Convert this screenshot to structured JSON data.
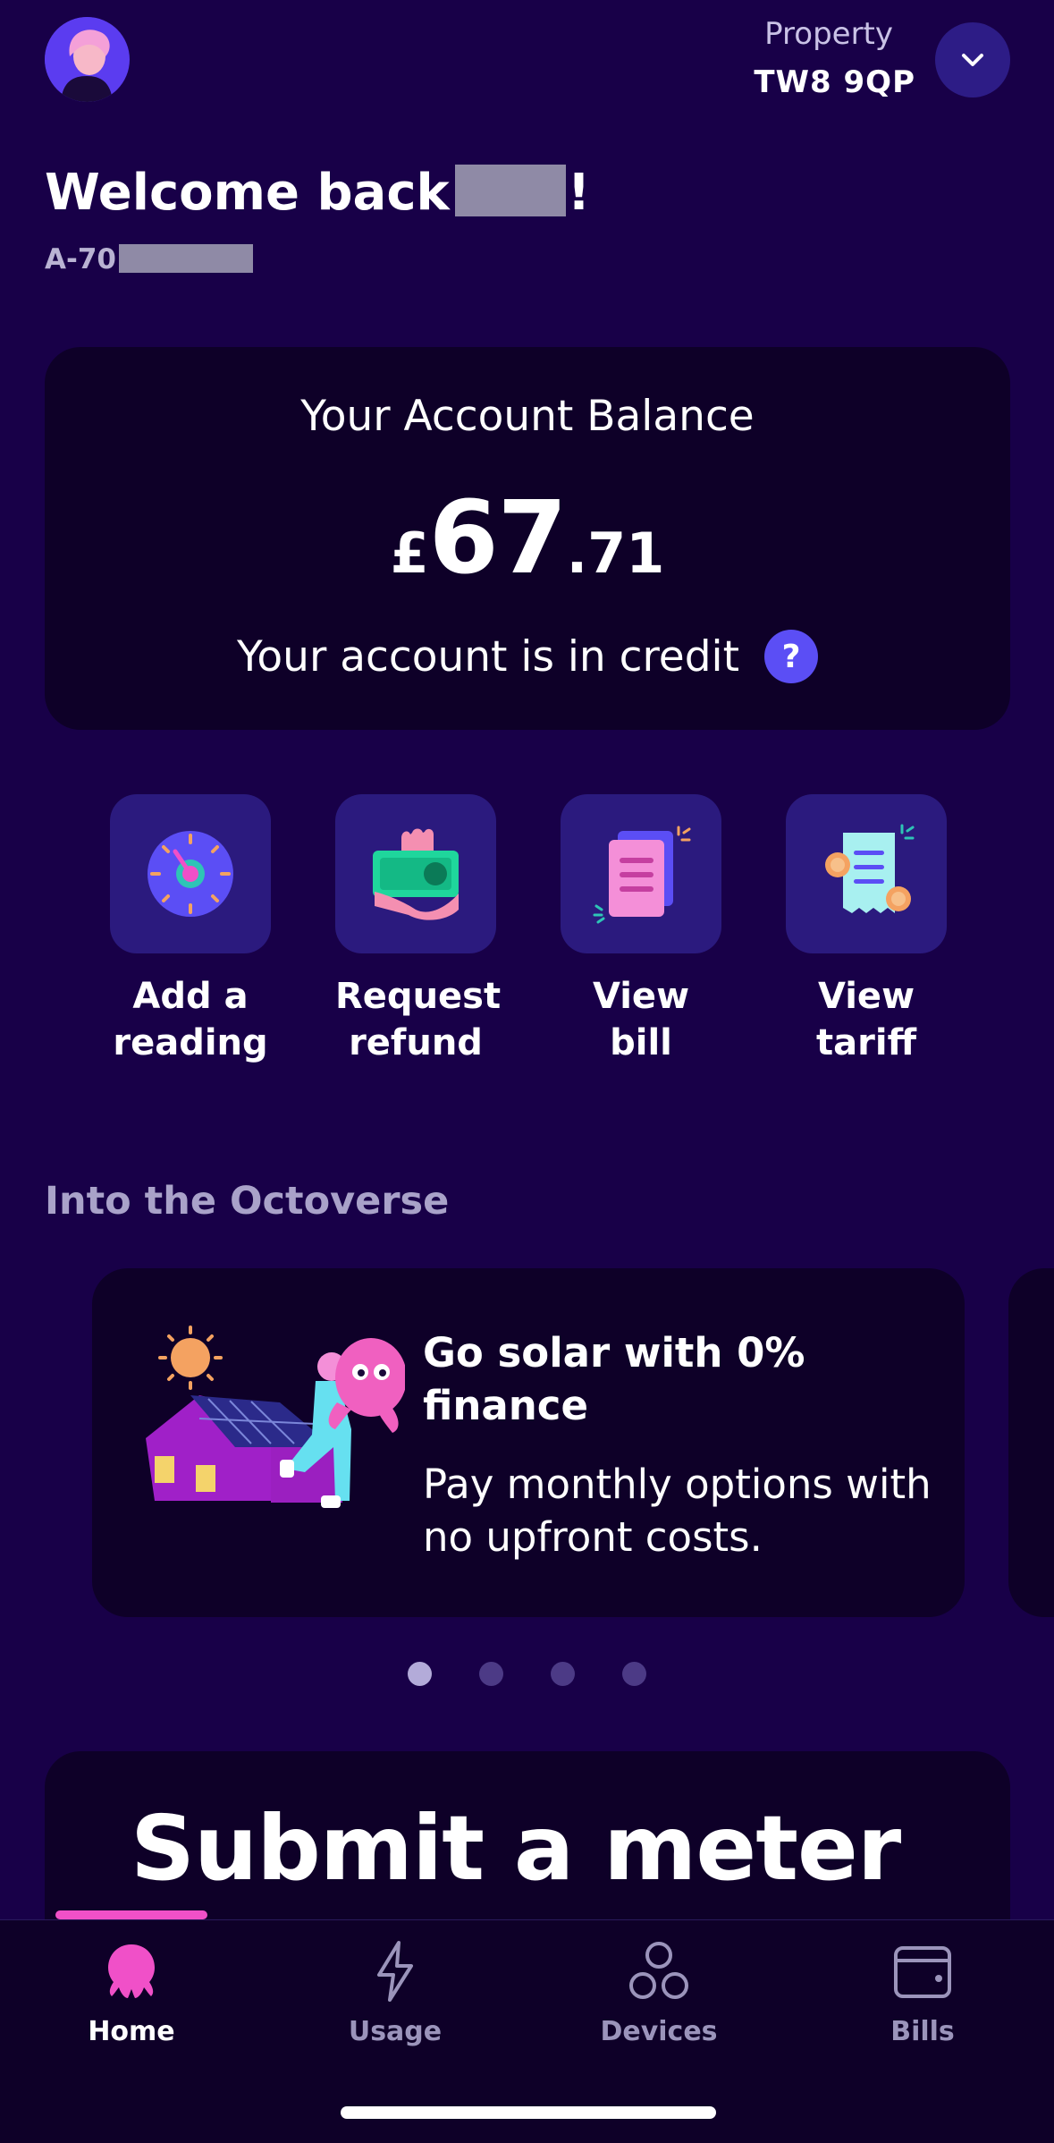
{
  "header": {
    "property_label": "Property",
    "property_postcode": "TW8 9QP",
    "welcome_prefix": "Welcome back",
    "welcome_suffix": "!",
    "account_prefix": "A-70"
  },
  "balance": {
    "title": "Your Account Balance",
    "currency": "£",
    "pounds": "67",
    "pence": ".71",
    "status": "Your account is in credit",
    "help_icon": "?"
  },
  "quick_actions": [
    {
      "line1": "Add a",
      "line2": "reading",
      "icon": "meter-dial-icon"
    },
    {
      "line1": "Request",
      "line2": "refund",
      "icon": "hand-cash-icon"
    },
    {
      "line1": "View",
      "line2": "bill",
      "icon": "bill-document-icon"
    },
    {
      "line1": "View",
      "line2": "tariff",
      "icon": "receipt-coins-icon"
    }
  ],
  "octoverse": {
    "section_title": "Into the Octoverse",
    "promo_title": "Go solar with 0% finance",
    "promo_body": "Pay monthly options with no upfront costs.",
    "dots_total": 4,
    "dots_active": 1
  },
  "meter_card": {
    "title": "Submit a meter"
  },
  "nav": {
    "items": [
      {
        "label": "Home",
        "icon": "octopus-icon",
        "active": true
      },
      {
        "label": "Usage",
        "icon": "lightning-icon",
        "active": false
      },
      {
        "label": "Devices",
        "icon": "devices-icon",
        "active": false
      },
      {
        "label": "Bills",
        "icon": "wallet-icon",
        "active": false
      }
    ]
  },
  "colors": {
    "background": "#180048",
    "card": "#0e0028",
    "tile": "#2b1a7e",
    "accent_pink": "#f050c8",
    "accent_purple": "#5b4ef5"
  }
}
